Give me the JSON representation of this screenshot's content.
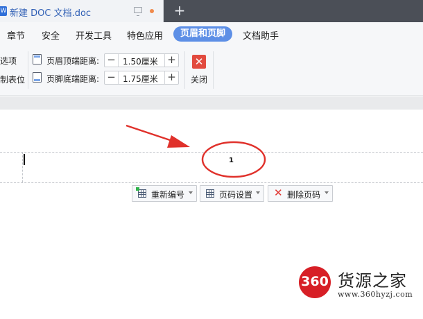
{
  "window": {
    "document_title": "新建 DOC 文档.doc",
    "doc_icon_letter": "W",
    "new_tab_symbol": "+"
  },
  "menu": {
    "tabs": [
      {
        "label": "章节"
      },
      {
        "label": "安全"
      },
      {
        "label": "开发工具"
      },
      {
        "label": "特色应用"
      },
      {
        "label": "页眉和页脚",
        "active": true
      },
      {
        "label": "文档助手"
      }
    ]
  },
  "ribbon": {
    "left_partial_1": "选项",
    "left_partial_2": "制表位",
    "header_distance": {
      "label": "页眉顶端距离:",
      "value": "1.50厘米"
    },
    "footer_distance": {
      "label": "页脚底端距离:",
      "value": "1.75厘米"
    },
    "spin_minus": "−",
    "spin_plus": "+",
    "close": {
      "icon_symbol": "✕",
      "label": "关闭"
    }
  },
  "document": {
    "page_number": "1",
    "toolbar": {
      "renumber_label": "重新编号",
      "page_number_settings_label": "页码设置",
      "delete_page_number_label": "删除页码",
      "delete_symbol": "✕"
    }
  },
  "watermark": {
    "logo_text": "360",
    "name": "货源之家",
    "url": "www.360hyzj.com"
  },
  "colors": {
    "active_tab": "#5d8fe6",
    "close_button": "#e24b3f",
    "annotation_red": "#e0312b",
    "watermark_red": "#d71f26"
  }
}
